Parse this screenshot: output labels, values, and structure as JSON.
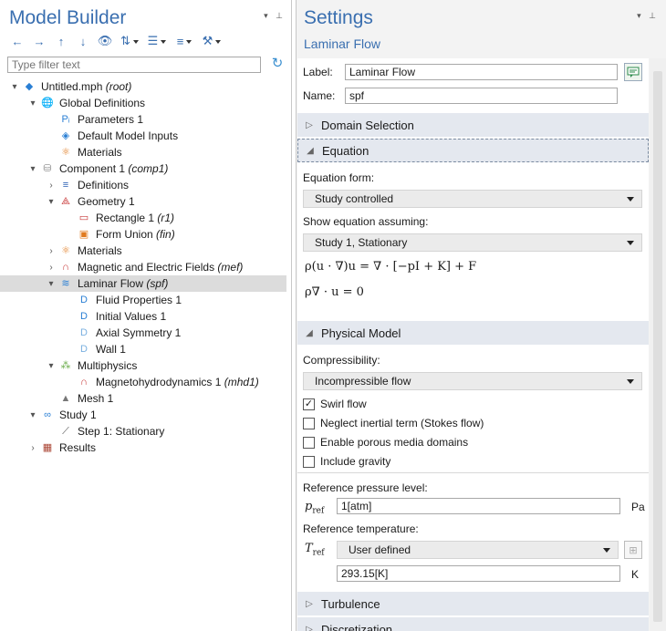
{
  "model_builder": {
    "title": "Model Builder",
    "pane_icons": "▾ ⊥",
    "toolbar": [
      {
        "name": "back-icon",
        "glyph": "←"
      },
      {
        "name": "forward-icon",
        "glyph": "→"
      },
      {
        "name": "move-up-icon",
        "glyph": "↑"
      },
      {
        "name": "move-down-icon",
        "glyph": "↓"
      },
      {
        "name": "show-icon",
        "glyph": "👁"
      },
      {
        "name": "collapse-icon",
        "glyph": "⇅"
      },
      {
        "name": "expand-icon",
        "glyph": "☰"
      },
      {
        "name": "sort-icon",
        "glyph": "≡"
      },
      {
        "name": "build-icon",
        "glyph": "⚒"
      }
    ],
    "filter_placeholder": "Type filter text",
    "tree": [
      {
        "label": "Untitled.mph",
        "italic": "(root)",
        "level": 0,
        "toggle": "▾",
        "icon": "◆",
        "color": "#2a7fd4",
        "name": "tree-root"
      },
      {
        "label": "Global Definitions",
        "italic": "",
        "level": 1,
        "toggle": "▾",
        "icon": "🌐",
        "color": "#2a7fd4",
        "name": "tree-global-definitions"
      },
      {
        "label": "Parameters 1",
        "italic": "",
        "level": 2,
        "toggle": "",
        "icon": "Pᵢ",
        "color": "#2a7fd4",
        "name": "tree-parameters-1"
      },
      {
        "label": "Default Model Inputs",
        "italic": "",
        "level": 2,
        "toggle": "",
        "icon": "◈",
        "color": "#2a7fd4",
        "name": "tree-default-model-inputs"
      },
      {
        "label": "Materials",
        "italic": "",
        "level": 2,
        "toggle": "",
        "icon": "⚛",
        "color": "#e07a1f",
        "name": "tree-global-materials"
      },
      {
        "label": "Component 1",
        "italic": "(comp1)",
        "level": 1,
        "toggle": "▾",
        "icon": "⛁",
        "color": "#888",
        "name": "tree-component-1"
      },
      {
        "label": "Definitions",
        "italic": "",
        "level": 2,
        "toggle": "›",
        "icon": "≡",
        "color": "#2a5fb4",
        "name": "tree-definitions"
      },
      {
        "label": "Geometry 1",
        "italic": "",
        "level": 2,
        "toggle": "▾",
        "icon": "⟁",
        "color": "#c83a3a",
        "name": "tree-geometry-1"
      },
      {
        "label": "Rectangle 1",
        "italic": "(r1)",
        "level": 3,
        "toggle": "",
        "icon": "▭",
        "color": "#c83a3a",
        "name": "tree-rectangle-1"
      },
      {
        "label": "Form Union",
        "italic": "(fin)",
        "level": 3,
        "toggle": "",
        "icon": "▣",
        "color": "#e07a1f",
        "name": "tree-form-union"
      },
      {
        "label": "Materials",
        "italic": "",
        "level": 2,
        "toggle": "›",
        "icon": "⚛",
        "color": "#e07a1f",
        "name": "tree-materials"
      },
      {
        "label": "Magnetic and Electric Fields",
        "italic": "(mef)",
        "level": 2,
        "toggle": "›",
        "icon": "∩",
        "color": "#c83a3a",
        "name": "tree-mef"
      },
      {
        "label": "Laminar Flow",
        "italic": "(spf)",
        "level": 2,
        "toggle": "▾",
        "icon": "≋",
        "color": "#2a7fd4",
        "name": "tree-laminar-flow",
        "selected": true
      },
      {
        "label": "Fluid Properties 1",
        "italic": "",
        "level": 3,
        "toggle": "",
        "icon": "D",
        "color": "#2a7fd4",
        "name": "tree-fluid-properties-1"
      },
      {
        "label": "Initial Values 1",
        "italic": "",
        "level": 3,
        "toggle": "",
        "icon": "D",
        "color": "#2a7fd4",
        "name": "tree-initial-values-1"
      },
      {
        "label": "Axial Symmetry 1",
        "italic": "",
        "level": 3,
        "toggle": "",
        "icon": "D",
        "color": "#7ab0e0",
        "name": "tree-axial-symmetry-1"
      },
      {
        "label": "Wall 1",
        "italic": "",
        "level": 3,
        "toggle": "",
        "icon": "D",
        "color": "#7ab0e0",
        "name": "tree-wall-1"
      },
      {
        "label": "Multiphysics",
        "italic": "",
        "level": 2,
        "toggle": "▾",
        "icon": "⁂",
        "color": "#6a4",
        "name": "tree-multiphysics"
      },
      {
        "label": "Magnetohydrodynamics 1",
        "italic": "(mhd1)",
        "level": 3,
        "toggle": "",
        "icon": "∩",
        "color": "#c83a3a",
        "name": "tree-mhd-1"
      },
      {
        "label": "Mesh 1",
        "italic": "",
        "level": 2,
        "toggle": "",
        "icon": "▲",
        "color": "#777",
        "name": "tree-mesh-1"
      },
      {
        "label": "Study 1",
        "italic": "",
        "level": 1,
        "toggle": "▾",
        "icon": "∞",
        "color": "#2a7fd4",
        "name": "tree-study-1"
      },
      {
        "label": "Step 1: Stationary",
        "italic": "",
        "level": 2,
        "toggle": "",
        "icon": "⟋",
        "color": "#555",
        "name": "tree-step-1-stationary"
      },
      {
        "label": "Results",
        "italic": "",
        "level": 1,
        "toggle": "›",
        "icon": "▦",
        "color": "#a43",
        "name": "tree-results"
      }
    ]
  },
  "settings": {
    "title": "Settings",
    "subtitle": "Laminar Flow",
    "pane_icons": "▾ ⊥",
    "label_caption": "Label:",
    "label_value": "Laminar Flow",
    "name_caption": "Name:",
    "name_value": "spf",
    "sections": {
      "domain_selection": "Domain Selection",
      "equation": "Equation",
      "physical_model": "Physical Model",
      "turbulence": "Turbulence",
      "discretization": "Discretization"
    },
    "equation_form_caption": "Equation form:",
    "equation_form_value": "Study controlled",
    "show_equation_caption": "Show equation assuming:",
    "show_equation_value": "Study 1, Stationary",
    "equation_line1": "ρ(u · ∇)u = ∇ · [−pI + K] + F",
    "equation_line2": "ρ∇ · u = 0",
    "compressibility_caption": "Compressibility:",
    "compressibility_value": "Incompressible flow",
    "checkboxes": [
      {
        "label": "Swirl flow",
        "checked": true,
        "name": "swirl-flow-checkbox"
      },
      {
        "label": "Neglect inertial term (Stokes flow)",
        "checked": false,
        "name": "neglect-inertial-checkbox"
      },
      {
        "label": "Enable porous media domains",
        "checked": false,
        "name": "porous-media-checkbox"
      },
      {
        "label": "Include gravity",
        "checked": false,
        "name": "include-gravity-checkbox"
      }
    ],
    "ref_pressure_caption": "Reference pressure level:",
    "p_ref_symbol": "p",
    "p_ref_sub": "ref",
    "p_ref_value": "1[atm]",
    "p_ref_unit": "Pa",
    "ref_temperature_caption": "Reference temperature:",
    "t_ref_symbol": "T",
    "t_ref_sub": "ref",
    "t_ref_mode": "User defined",
    "t_ref_value": "293.15[K]",
    "t_ref_unit": "K"
  }
}
